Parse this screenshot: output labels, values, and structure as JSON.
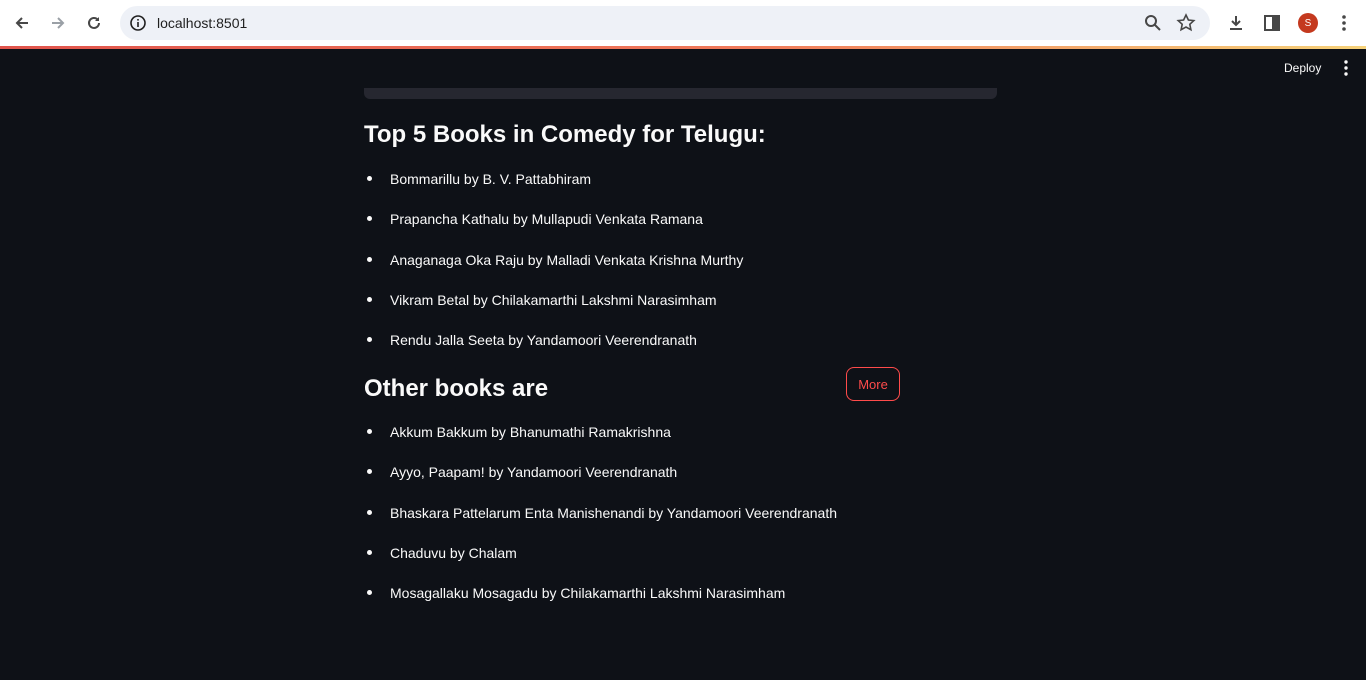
{
  "browser": {
    "url": "localhost:8501",
    "profile_initial": "S",
    "profile_color": "#c4391e"
  },
  "app": {
    "deploy_label": "Deploy",
    "accent_color": "#ff4b4b"
  },
  "top_section": {
    "heading": "Top 5 Books in Comedy for Telugu:",
    "books": [
      "Bommarillu by B. V. Pattabhiram",
      "Prapancha Kathalu by Mullapudi Venkata Ramana",
      "Anaganaga Oka Raju by Malladi Venkata Krishna Murthy",
      "Vikram Betal by Chilakamarthi Lakshmi Narasimham",
      "Rendu Jalla Seeta by Yandamoori Veerendranath"
    ]
  },
  "other_section": {
    "heading": "Other books are",
    "more_button": "More",
    "books": [
      "Akkum Bakkum by Bhanumathi Ramakrishna",
      "Ayyo, Paapam! by Yandamoori Veerendranath",
      "Bhaskara Pattelarum Enta Manishenandi by Yandamoori Veerendranath",
      "Chaduvu by Chalam",
      "Mosagallaku Mosagadu by Chilakamarthi Lakshmi Narasimham"
    ]
  }
}
